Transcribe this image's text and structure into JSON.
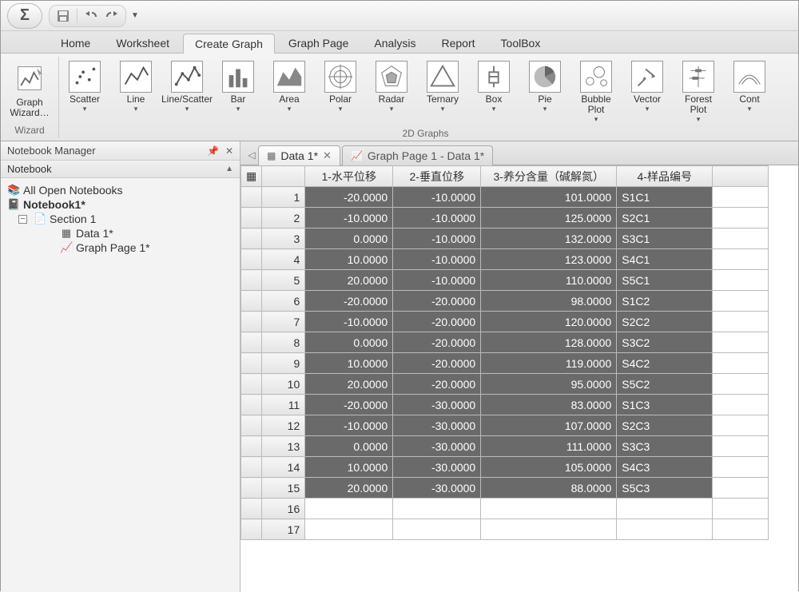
{
  "app_symbol": "Σ",
  "ribbon_tabs": [
    "Home",
    "Worksheet",
    "Create Graph",
    "Graph Page",
    "Analysis",
    "Report",
    "ToolBox"
  ],
  "active_ribbon_tab": "Create Graph",
  "ribbon": {
    "wizard_label": "Graph\nWizard…",
    "group1_label": "Wizard",
    "buttons": [
      {
        "name": "scatter",
        "label": "Scatter"
      },
      {
        "name": "line",
        "label": "Line"
      },
      {
        "name": "linescatter",
        "label": "Line/Scatter"
      },
      {
        "name": "bar",
        "label": "Bar"
      },
      {
        "name": "area",
        "label": "Area"
      },
      {
        "name": "polar",
        "label": "Polar"
      },
      {
        "name": "radar",
        "label": "Radar"
      },
      {
        "name": "ternary",
        "label": "Ternary"
      },
      {
        "name": "box",
        "label": "Box"
      },
      {
        "name": "pie",
        "label": "Pie"
      },
      {
        "name": "bubble",
        "label": "Bubble\nPlot"
      },
      {
        "name": "vector",
        "label": "Vector"
      },
      {
        "name": "forest",
        "label": "Forest\nPlot"
      },
      {
        "name": "contour",
        "label": "Cont"
      }
    ],
    "group2_label": "2D Graphs"
  },
  "panel": {
    "title": "Notebook Manager",
    "sub": "Notebook",
    "tree": {
      "all": "All Open Notebooks",
      "nb": "Notebook1*",
      "section": "Section 1",
      "data": "Data 1*",
      "graph": "Graph Page 1*"
    }
  },
  "doc_tabs": {
    "active": "Data 1*",
    "inactive": "Graph Page 1 - Data 1*"
  },
  "sheet": {
    "headers": [
      "1-水平位移",
      "2-垂直位移",
      "3-养分含量（碱解氮）",
      "4-样品编号"
    ],
    "rows": [
      [
        "-20.0000",
        "-10.0000",
        "101.0000",
        "S1C1"
      ],
      [
        "-10.0000",
        "-10.0000",
        "125.0000",
        "S2C1"
      ],
      [
        "0.0000",
        "-10.0000",
        "132.0000",
        "S3C1"
      ],
      [
        "10.0000",
        "-10.0000",
        "123.0000",
        "S4C1"
      ],
      [
        "20.0000",
        "-10.0000",
        "110.0000",
        "S5C1"
      ],
      [
        "-20.0000",
        "-20.0000",
        "98.0000",
        "S1C2"
      ],
      [
        "-10.0000",
        "-20.0000",
        "120.0000",
        "S2C2"
      ],
      [
        "0.0000",
        "-20.0000",
        "128.0000",
        "S3C2"
      ],
      [
        "10.0000",
        "-20.0000",
        "119.0000",
        "S4C2"
      ],
      [
        "20.0000",
        "-20.0000",
        "95.0000",
        "S5C2"
      ],
      [
        "-20.0000",
        "-30.0000",
        "83.0000",
        "S1C3"
      ],
      [
        "-10.0000",
        "-30.0000",
        "107.0000",
        "S2C3"
      ],
      [
        "0.0000",
        "-30.0000",
        "111.0000",
        "S3C3"
      ],
      [
        "10.0000",
        "-30.0000",
        "105.0000",
        "S4C3"
      ],
      [
        "20.0000",
        "-30.0000",
        "88.0000",
        "S5C3"
      ]
    ],
    "empty_rows": [
      16,
      17
    ]
  }
}
